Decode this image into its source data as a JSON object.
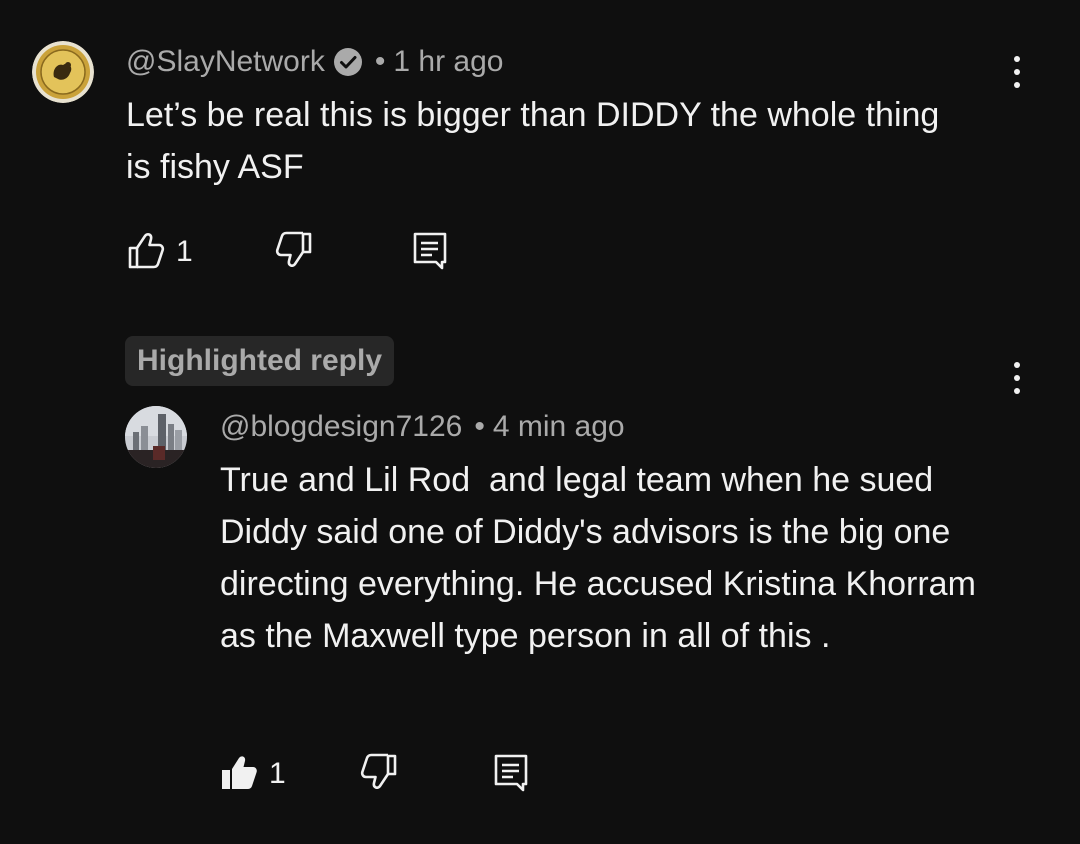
{
  "comment": {
    "handle": "@SlayNetwork",
    "separator": "•",
    "time": "1 hr ago",
    "text": "Let’s be real this is bigger than DIDDY the whole thing is fishy ASF",
    "likes": "1",
    "verified": true
  },
  "reply_badge": "Highlighted reply",
  "reply": {
    "handle": "@blogdesign7126",
    "separator": "•",
    "time": "4 min ago",
    "text": "True and Lil Rod  and legal team when he sued Diddy said one of Diddy's advisors is the big one directing everything. He accused Kristina Khorram as the Maxwell type person in all of this .",
    "likes": "1",
    "liked": true
  },
  "icons": {
    "like": "thumbs-up-icon",
    "dislike": "thumbs-down-icon",
    "reply": "reply-comment-icon",
    "more": "more-vert-icon",
    "verified": "verified-check-icon"
  },
  "colors": {
    "background": "#0f0f0f",
    "text_primary": "#f1f1f1",
    "text_secondary": "#aaaaaa",
    "badge_bg": "#272727"
  }
}
